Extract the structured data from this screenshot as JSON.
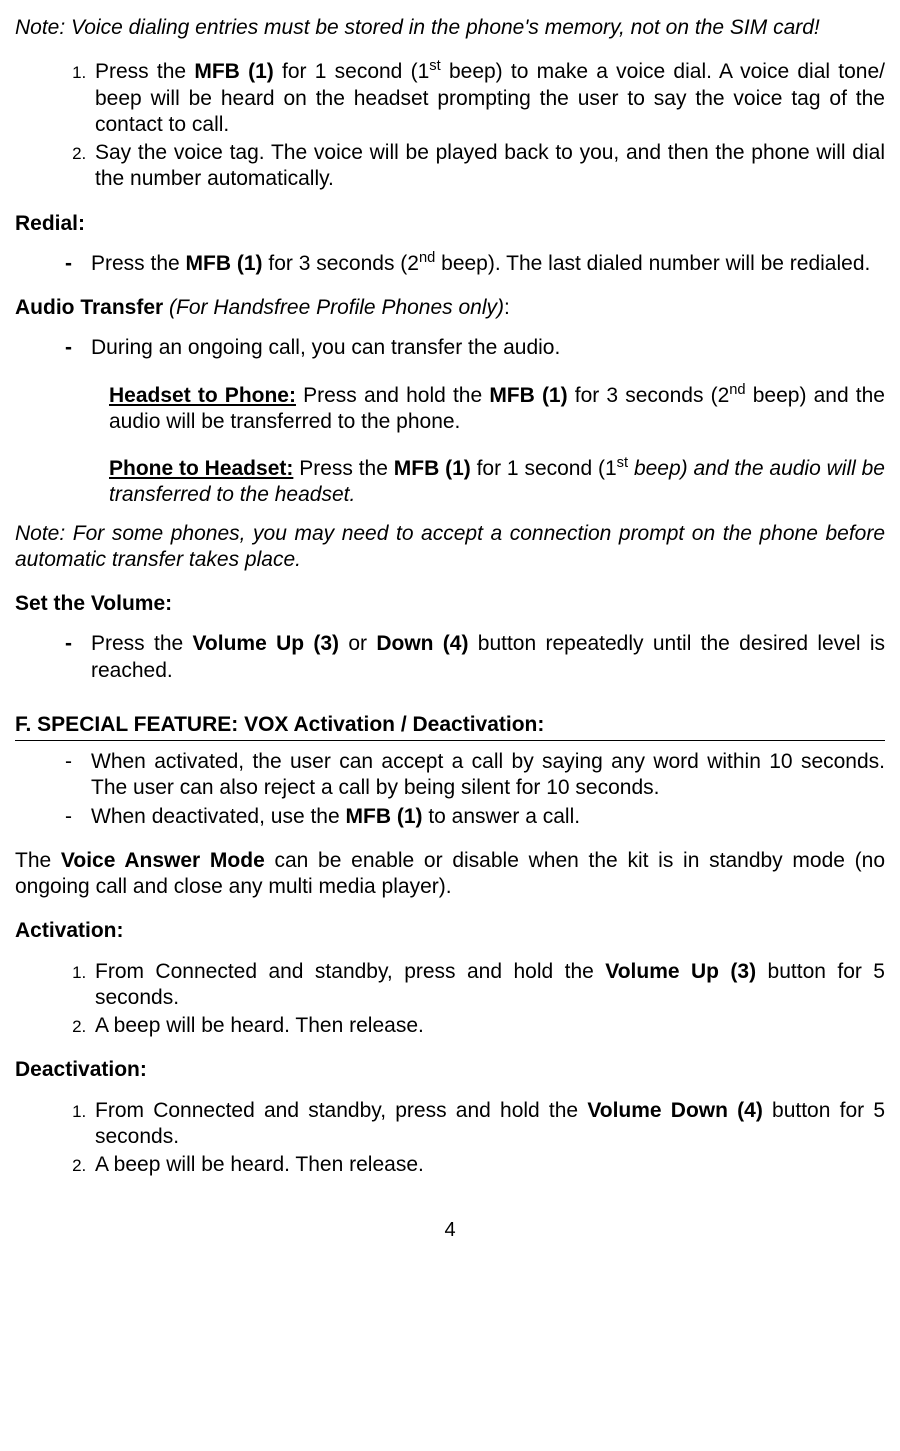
{
  "note1": "Note: Voice dialing entries must be stored in the phone's memory, not on the SIM card!",
  "voice_dial": {
    "step1_a": "Press the ",
    "step1_mfb": "MFB (1)",
    "step1_b": " for 1 second (1",
    "step1_sup": "st",
    "step1_c": "  beep) to make a voice dial. A voice dial tone/ beep will be heard on the headset prompting the user to say the voice tag of the contact to call.",
    "step2": "Say the voice tag. The voice will be played back to you, and then the phone will dial the number automatically."
  },
  "redial": {
    "heading": "Redial:",
    "a": "Press the ",
    "mfb": "MFB (1)",
    "b": " for 3 seconds (2",
    "sup": "nd",
    "c": " beep).  The last dialed number will be redialed."
  },
  "audio_transfer": {
    "heading_a": "Audio Transfer ",
    "heading_b": "(For Handsfree Profile Phones only)",
    "heading_c": ":",
    "li": "During an ongoing call, you can transfer the audio.",
    "h2p_label": "Headset to Phone:",
    "h2p_a": " Press and hold the ",
    "h2p_mfb": "MFB (1)",
    "h2p_b": " for 3 seconds (2",
    "h2p_sup": "nd",
    "h2p_c": " beep) and the audio will be transferred to the phone.",
    "p2h_label": "Phone to Headset:",
    "p2h_a": " Press the ",
    "p2h_mfb": "MFB (1)",
    "p2h_b": " for 1 second (1",
    "p2h_sup": "st",
    "p2h_c": " beep) and the audio will be transferred to the headset."
  },
  "note2": "Note:  For some phones, you may need to accept a connection prompt on the phone before automatic transfer takes place.",
  "volume": {
    "heading": "Set the Volume:",
    "a": "Press the ",
    "up": "Volume Up (3)",
    "b": " or ",
    "down": "Down (4)",
    "c": " button repeatedly until the desired level is reached."
  },
  "section_f": "F. SPECIAL FEATURE: VOX Activation / Deactivation:",
  "vox": {
    "li1": "When activated, the user can accept a call by saying any word within 10 seconds. The user can also reject a call by being silent for 10 seconds.",
    "li2_a": "When deactivated, use the ",
    "li2_mfb": "MFB (1)",
    "li2_b": " to answer a call."
  },
  "vam_a": "The ",
  "vam_b": "Voice Answer Mode",
  "vam_c": " can be enable or disable when the kit is in standby mode (no ongoing call and close any multi media player).",
  "activation": {
    "heading": "Activation:",
    "step1_a": "From Connected and standby, press and hold the ",
    "step1_btn": "Volume Up (3)",
    "step1_b": " button for 5 seconds.",
    "step2": "A beep will be heard. Then release."
  },
  "deactivation": {
    "heading": "Deactivation:",
    "step1_a": "From Connected and standby, press and hold the ",
    "step1_btn": "Volume Down (4)",
    "step1_b": " button for 5 seconds.",
    "step2": "A beep will be heard. Then release."
  },
  "page_number": "4"
}
